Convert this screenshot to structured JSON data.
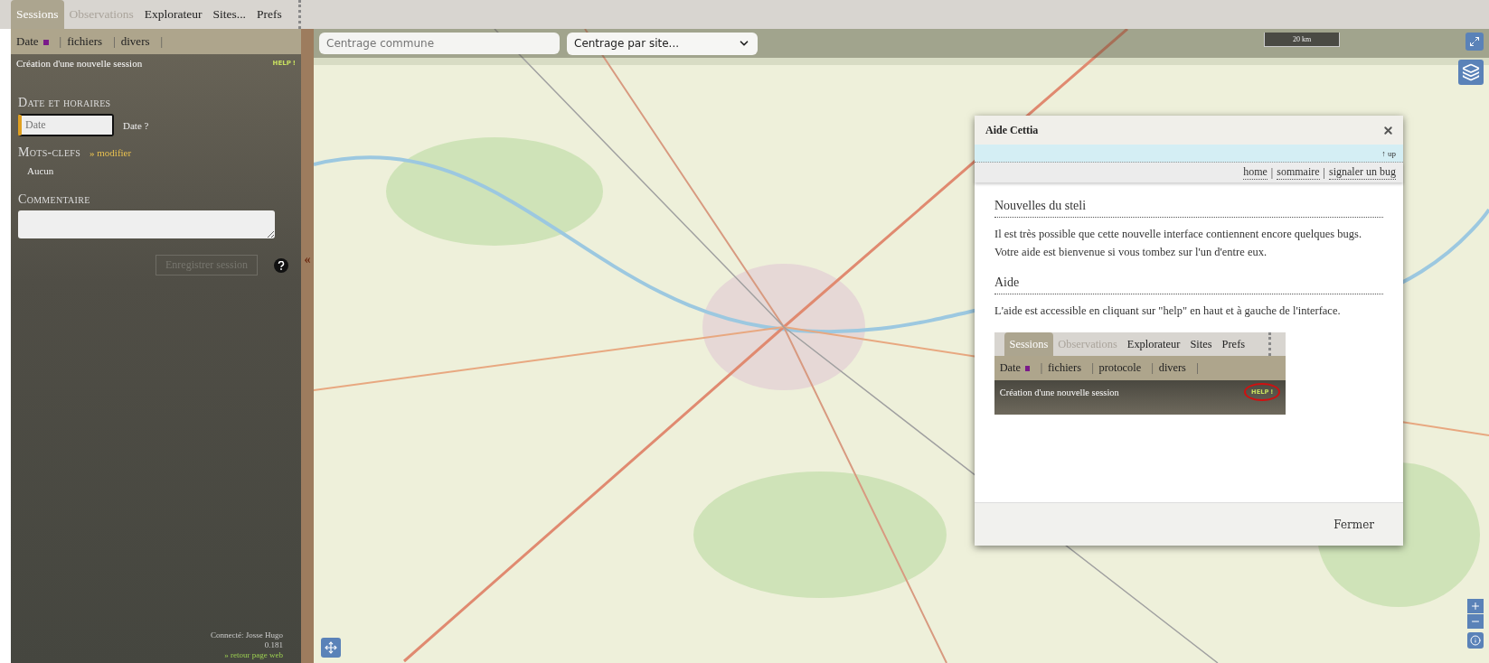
{
  "tabs": [
    {
      "label": "Sessions",
      "selected": true,
      "disabled": false
    },
    {
      "label": "Observations",
      "selected": false,
      "disabled": true
    },
    {
      "label": "Explorateur",
      "selected": false,
      "disabled": false
    },
    {
      "label": "Sites...",
      "selected": false,
      "disabled": false
    },
    {
      "label": "Prefs",
      "selected": false,
      "disabled": false
    }
  ],
  "subnav": [
    {
      "label": "Date",
      "marked": true,
      "sep": "|"
    },
    {
      "label": "fichiers",
      "marked": false,
      "sep": "|"
    },
    {
      "label": "divers",
      "marked": false,
      "sep": "|"
    }
  ],
  "panel": {
    "title": "Création d'une nouvelle session",
    "help": "HELP",
    "help_mark": "!"
  },
  "date_section": {
    "heading": "Date et horaires",
    "placeholder": "Date",
    "hint": "Date ?"
  },
  "keywords_section": {
    "heading": "Mots-clefs",
    "link": "» modifier",
    "value": "Aucun"
  },
  "comment_section": {
    "heading": "Commentaire"
  },
  "save_button": {
    "label": "Enregistrer session",
    "disabled": true
  },
  "collapse": "«",
  "footer": {
    "user": "Connecté: Josse Hugo",
    "version": "0.181",
    "link": "» retour page web"
  },
  "map": {
    "commune_placeholder": "Centrage commune",
    "site_select": "Centrage par site...",
    "scale": "20 km"
  },
  "dialog": {
    "title": "Aide Cettia",
    "up": "↑ up",
    "links": [
      "home",
      "sommaire",
      "signaler un bug"
    ],
    "link_separator": "|",
    "sections": [
      {
        "heading": "Nouvelles du steli",
        "text": "Il est très possible que cette nouvelle interface contiennent encore quelques bugs. Votre aide est bienvenue si vous tombez sur l'un d'entre eux."
      },
      {
        "heading": "Aide",
        "text": "L'aide est accessible en cliquant sur \"help\" en haut et à gauche de l'interface."
      }
    ],
    "shot": {
      "tabs": [
        {
          "label": "Sessions",
          "selected": true,
          "disabled": false
        },
        {
          "label": "Observations",
          "selected": false,
          "disabled": true
        },
        {
          "label": "Explorateur",
          "selected": false,
          "disabled": false
        },
        {
          "label": "Sites",
          "selected": false,
          "disabled": false
        },
        {
          "label": "Prefs",
          "selected": false,
          "disabled": false
        }
      ],
      "subnav": [
        {
          "label": "Date",
          "marked": true,
          "sep": "|"
        },
        {
          "label": "fichiers",
          "marked": false,
          "sep": "|"
        },
        {
          "label": "protocole",
          "marked": false,
          "sep": "|"
        },
        {
          "label": "divers",
          "marked": false,
          "sep": "|"
        }
      ],
      "title": "Création d'une nouvelle session",
      "help": "HELP",
      "help_mark": "!",
      "circled": true
    },
    "button": "Fermer"
  }
}
